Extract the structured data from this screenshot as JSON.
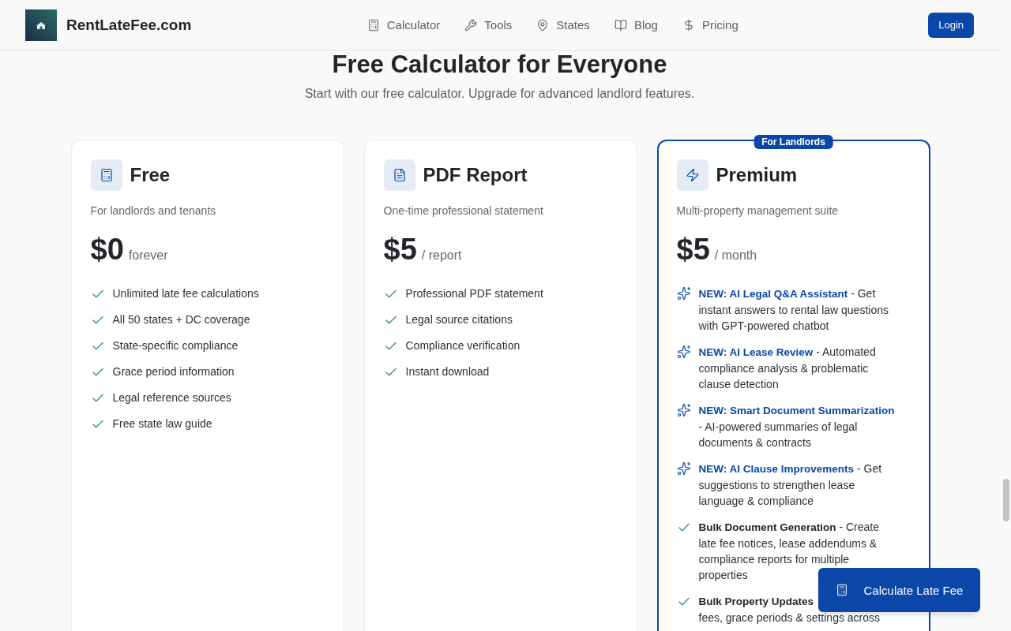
{
  "header": {
    "brand": "RentLateFee.com",
    "nav": [
      {
        "label": "Calculator"
      },
      {
        "label": "Tools"
      },
      {
        "label": "States"
      },
      {
        "label": "Blog"
      },
      {
        "label": "Pricing"
      }
    ],
    "login": "Login"
  },
  "hero": {
    "title": "Free Calculator for Everyone",
    "subtitle": "Start with our free calculator. Upgrade for advanced landlord features."
  },
  "plans": [
    {
      "name": "Free",
      "description": "For landlords and tenants",
      "price": "$0",
      "period": "forever",
      "features": [
        {
          "kind": "check",
          "text": "Unlimited late fee calculations"
        },
        {
          "kind": "check",
          "text": "All 50 states + DC coverage"
        },
        {
          "kind": "check",
          "text": "State-specific compliance"
        },
        {
          "kind": "check",
          "text": "Grace period information"
        },
        {
          "kind": "check",
          "text": "Legal reference sources"
        },
        {
          "kind": "check",
          "text": "Free state law guide"
        }
      ]
    },
    {
      "name": "PDF Report",
      "description": "One-time professional statement",
      "price": "$5",
      "period": "/ report",
      "features": [
        {
          "kind": "check",
          "text": "Professional PDF statement"
        },
        {
          "kind": "check",
          "text": "Legal source citations"
        },
        {
          "kind": "check",
          "text": "Compliance verification"
        },
        {
          "kind": "check",
          "text": "Instant download"
        }
      ]
    },
    {
      "name": "Premium",
      "badge": "For Landlords",
      "description": "Multi-property management suite",
      "price": "$5",
      "period": "/ month",
      "features": [
        {
          "kind": "ai",
          "title": "NEW: AI Legal Q&A Assistant",
          "text": "- Get instant answers to rental law questions with GPT-powered chatbot"
        },
        {
          "kind": "ai",
          "title": "NEW: AI Lease Review",
          "text": "- Automated compliance analysis & problematic clause detection"
        },
        {
          "kind": "ai",
          "title": "NEW: Smart Document Summarization",
          "text": "- AI-powered summaries of legal documents & contracts"
        },
        {
          "kind": "ai",
          "title": "NEW: AI Clause Improvements",
          "text": "- Get suggestions to strengthen lease language & compliance"
        },
        {
          "kind": "check",
          "title": "Bulk Document Generation",
          "text": "- Create late fee notices, lease addendums & compliance reports for multiple properties"
        },
        {
          "kind": "check",
          "title": "Bulk Property Updates",
          "text": "fees, grace periods & settings across",
          "break": true
        }
      ]
    }
  ],
  "floating_button": "Calculate Late Fee"
}
